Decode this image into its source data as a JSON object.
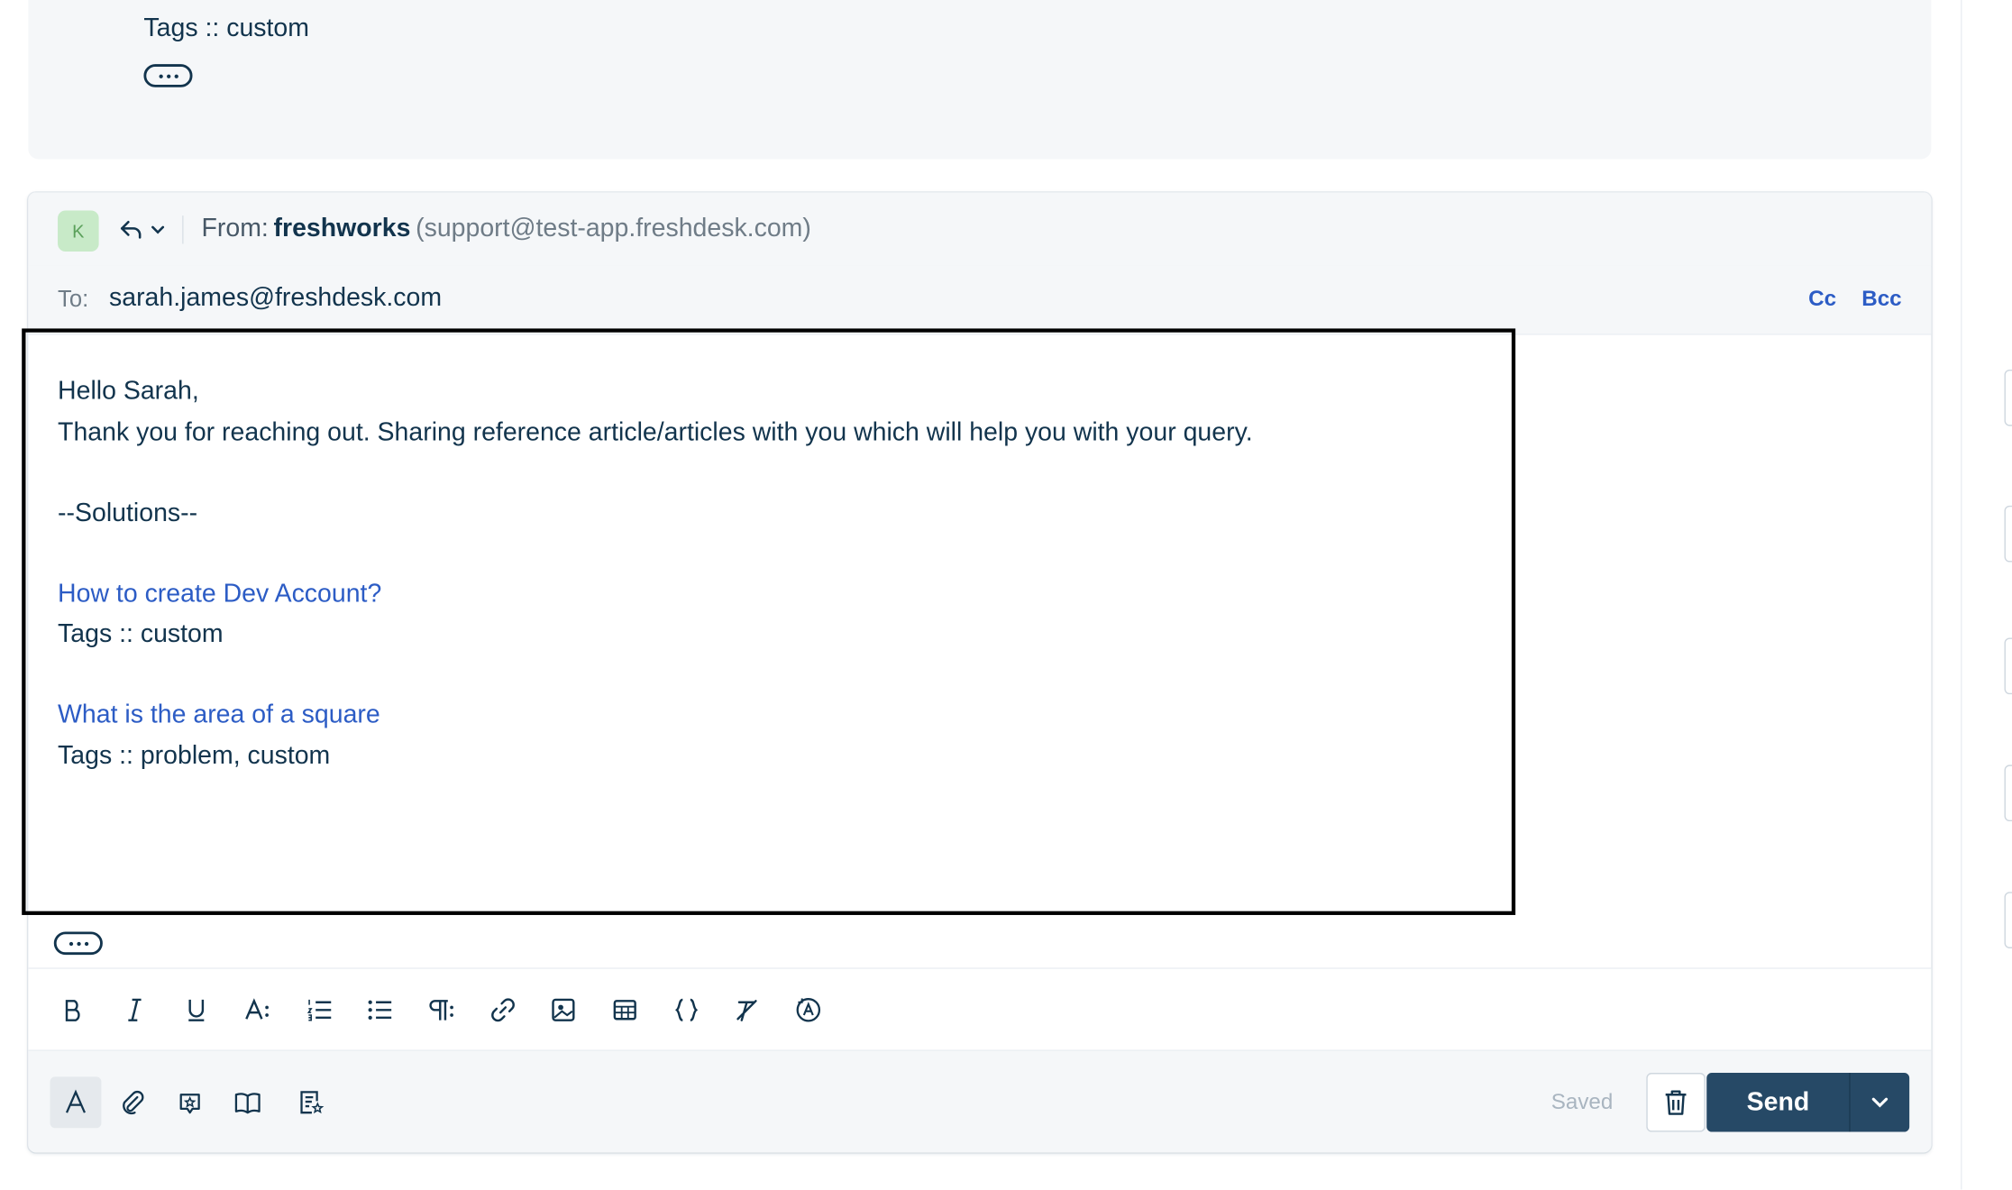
{
  "previous_message": {
    "tags_line": "Tags :: custom"
  },
  "reply": {
    "avatar_initial": "K",
    "from_label": "From:",
    "from_name": "freshworks",
    "from_email": "(support@test-app.freshdesk.com)",
    "to_label": "To:",
    "to_value": "sarah.james@freshdesk.com",
    "cc_label": "Cc",
    "bcc_label": "Bcc",
    "body": {
      "greeting": "Hello Sarah,",
      "intro": "Thank you for reaching out. Sharing reference article/articles with you which will help you with your query.",
      "solutions_header": "--Solutions--",
      "articles": [
        {
          "title": "How to create Dev Account?",
          "tags": "Tags :: custom"
        },
        {
          "title": "What is the area of a square",
          "tags": "Tags :: problem, custom"
        }
      ]
    }
  },
  "toolbar": {
    "icons": [
      "bold-icon",
      "italic-icon",
      "underline-icon",
      "font-size-icon",
      "numbered-list-icon",
      "bulleted-list-icon",
      "paragraph-format-icon",
      "link-icon",
      "image-icon",
      "table-icon",
      "code-icon",
      "clear-formatting-icon",
      "spell-check-icon"
    ]
  },
  "footer": {
    "icons": [
      "text-format-icon",
      "attachment-icon",
      "canned-response-icon",
      "solution-article-icon",
      "survey-icon"
    ],
    "saved_label": "Saved",
    "send_label": "Send"
  },
  "colors": {
    "accent_link": "#2c5cc5",
    "send_button": "#264966",
    "text_primary": "#12344d"
  }
}
